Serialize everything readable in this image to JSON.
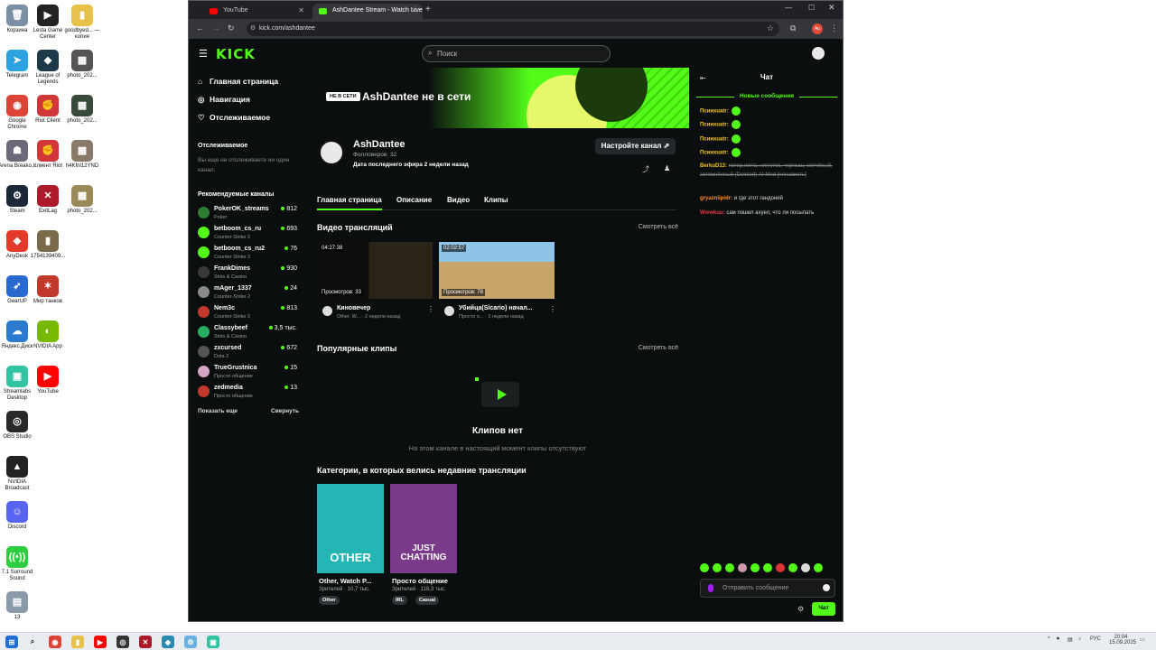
{
  "desktop": {
    "icons": [
      {
        "label": "Корзина",
        "color": "#7a8fa3",
        "glyph": "🗑"
      },
      {
        "label": "Lesta Game Center",
        "color": "#222222",
        "glyph": "▶"
      },
      {
        "label": "goodbyed... — копия",
        "color": "#e8c14a",
        "glyph": "▮"
      },
      {
        "label": "Telegram",
        "color": "#2aa3e0",
        "glyph": "➤"
      },
      {
        "label": "League of Legends",
        "color": "#1e3a4a",
        "glyph": "◆"
      },
      {
        "label": "photo_202...",
        "color": "#555555",
        "glyph": "▦"
      },
      {
        "label": "Google Chrome",
        "color": "#db4437",
        "glyph": "◉"
      },
      {
        "label": "Riot Client",
        "color": "#d13639",
        "glyph": "✊"
      },
      {
        "label": "photo_202...",
        "color": "#3a4a3a",
        "glyph": "▦"
      },
      {
        "label": "Arena Breako...",
        "color": "#6a6a7a",
        "glyph": "☗"
      },
      {
        "label": "Клиент Riot",
        "color": "#d13639",
        "glyph": "✊"
      },
      {
        "label": "h4Kfnl12YND",
        "color": "#8a7a6a",
        "glyph": "▦"
      },
      {
        "label": "Steam",
        "color": "#1b2838",
        "glyph": "⚙"
      },
      {
        "label": "ExitLag",
        "color": "#aa1a2a",
        "glyph": "✕"
      },
      {
        "label": "photo_202...",
        "color": "#9a8a5a",
        "glyph": "▦"
      },
      {
        "label": "AnyDesk",
        "color": "#e43a2a",
        "glyph": "◆"
      },
      {
        "label": "1754139409...",
        "color": "#7a6a4a",
        "glyph": "▮"
      },
      {
        "label": "GearUP",
        "color": "#2a6ad0",
        "glyph": "➶"
      },
      {
        "label": "Мир танков",
        "color": "#c0392b",
        "glyph": "✶"
      },
      {
        "label": "Яндекс.Диск",
        "color": "#2a7ad0",
        "glyph": "☁"
      },
      {
        "label": "NVIDIA App",
        "color": "#76b900",
        "glyph": "◐"
      },
      {
        "label": "Streamlabs Desktop",
        "color": "#31c3a2",
        "glyph": "▣"
      },
      {
        "label": "YouTube",
        "color": "#ff0000",
        "glyph": "▶"
      },
      {
        "label": "OBS Studio",
        "color": "#2a2a2a",
        "glyph": "◎"
      },
      {
        "label": "NVIDIA Broadcast",
        "color": "#222222",
        "glyph": "▲"
      },
      {
        "label": "Discord",
        "color": "#5865f2",
        "glyph": "☺"
      },
      {
        "label": "7.1 Surround Sound",
        "color": "#2ecc40",
        "glyph": "((•))"
      },
      {
        "label": "13",
        "color": "#8a9aaa",
        "glyph": "▤"
      }
    ]
  },
  "browser": {
    "tabs": [
      {
        "title": "YouTube",
        "icon": "youtube-icon",
        "color": "#ff0000"
      },
      {
        "title": "AshDantee Stream - Watch Live",
        "icon": "kick-icon",
        "color": "#53fc18"
      }
    ],
    "url": "kick.com/ashdantee",
    "profile_initials": "Au"
  },
  "kick": {
    "logo": "KICK",
    "search_placeholder": "Поиск",
    "nav": [
      {
        "label": "Главная страница",
        "icon": "home-icon"
      },
      {
        "label": "Навигация",
        "icon": "compass-icon"
      },
      {
        "label": "Отслеживаемое",
        "icon": "heart-icon"
      }
    ],
    "following": {
      "title": "Отслеживаемое",
      "empty": "Вы еще не отслеживаете ни один канал."
    },
    "recommended_title": "Рекомендуемые каналы",
    "recommended": [
      {
        "name": "PokerOK_streams",
        "category": "Poker",
        "viewers": "812",
        "color": "#2e7d32"
      },
      {
        "name": "betboom_cs_ru",
        "category": "Counter-Strike 2",
        "viewers": "693",
        "color": "#53fc18"
      },
      {
        "name": "betboom_cs_ru2",
        "category": "Counter-Strike 2",
        "viewers": "76",
        "color": "#53fc18"
      },
      {
        "name": "FrankDimes",
        "category": "Slots & Casino",
        "viewers": "930",
        "color": "#3a3a3a"
      },
      {
        "name": "mAger_1337",
        "category": "Counter-Strike 2",
        "viewers": "24",
        "color": "#8a8a8a"
      },
      {
        "name": "Nem3c",
        "category": "Counter-Strike 2",
        "viewers": "813",
        "color": "#c0392b"
      },
      {
        "name": "Classybeef",
        "category": "Slots & Casino",
        "viewers": "3,5 тыс.",
        "color": "#27ae60"
      },
      {
        "name": "zxcursed",
        "category": "Dota 2",
        "viewers": "672",
        "color": "#555555"
      },
      {
        "name": "TrueGrustnica",
        "category": "Просто общение",
        "viewers": "15",
        "color": "#d4a5c4"
      },
      {
        "name": "zedmedia",
        "category": "Просто общение",
        "viewers": "13",
        "color": "#c0392b"
      }
    ],
    "show_more": "Показать еще",
    "collapse": "Свернуть",
    "banner": {
      "badge": "НЕ В СЕТИ",
      "text": "AshDantee не в сети"
    },
    "channel": {
      "name": "AshDantee",
      "followers": "Фолловеров: 32",
      "last_stream": "Дата последнего эфира 2 недели назад",
      "configure": "Настройте канал"
    },
    "channel_tabs": [
      "Главная страница",
      "Описание",
      "Видео",
      "Клипы"
    ],
    "videos_title": "Видео трансляций",
    "see_all": "Смотреть всё",
    "videos": [
      {
        "duration": "04:27:38",
        "views": "Просмотров: 33",
        "title": "Киновечер",
        "meta": "Other, W... · 2 недели назад",
        "thumb": "#2a2418"
      },
      {
        "duration": "02:02:57",
        "views": "Просмотров: 78",
        "title": "Убийца(Sicario) начал...",
        "meta": "Просто о... · 2 недели назад",
        "thumb": "#c9a46a"
      }
    ],
    "clips_title": "Популярные клипы",
    "clips_empty_title": "Клипов нет",
    "clips_empty_sub": "На этом канале в настоящий момент клипы отсутствуют",
    "categories_title": "Категории, в которых велись недавние трансляции",
    "categories": [
      {
        "title": "Other, Watch P...",
        "viewers": "Зрителей · 10,7 тыс.",
        "tags": [
          "Other"
        ],
        "art": "OTHER",
        "color": "#26b5b5"
      },
      {
        "title": "Просто общение",
        "viewers": "Зрителей · 118,3 тыс.",
        "tags": [
          "IRL",
          "Casual"
        ],
        "art": "JUST CHATTING",
        "color": "#7a3a8a"
      }
    ]
  },
  "chat": {
    "title": "Чат",
    "new_messages": "Новые сообщения",
    "messages": [
      {
        "user": "Псииxuatr:",
        "text": "",
        "color": "#f5c518",
        "emote": true
      },
      {
        "user": "Псииxuatr:",
        "text": "",
        "color": "#f5c518",
        "emote": true
      },
      {
        "user": "Псииxuatr:",
        "text": "",
        "color": "#f5c518",
        "emote": true
      },
      {
        "user": "Псииxuatr:",
        "text": "",
        "color": "#f5c518",
        "emote": true
      },
      {
        "user": "BerkuD13:",
        "text": "нигер,нигга, ниггетос, черныш, копчёный, затемнённый (Deleted) AI Mod [ненависть]",
        "color": "#f5c518",
        "emote": false
      },
      {
        "user": "gryazniipidr:",
        "text": "и где этот гандоний",
        "color": "#ff8c1a",
        "emote": false
      },
      {
        "user": "Wwwkuu:",
        "text": "сам пошел ахуел, что ли посылать",
        "color": "#e23b3b",
        "emote": false
      }
    ],
    "input_placeholder": "Отправить сообщение",
    "send_label": "Чат"
  },
  "taskbar": {
    "lang": "РУС",
    "time": "20:04",
    "date": "15.09.2025"
  }
}
